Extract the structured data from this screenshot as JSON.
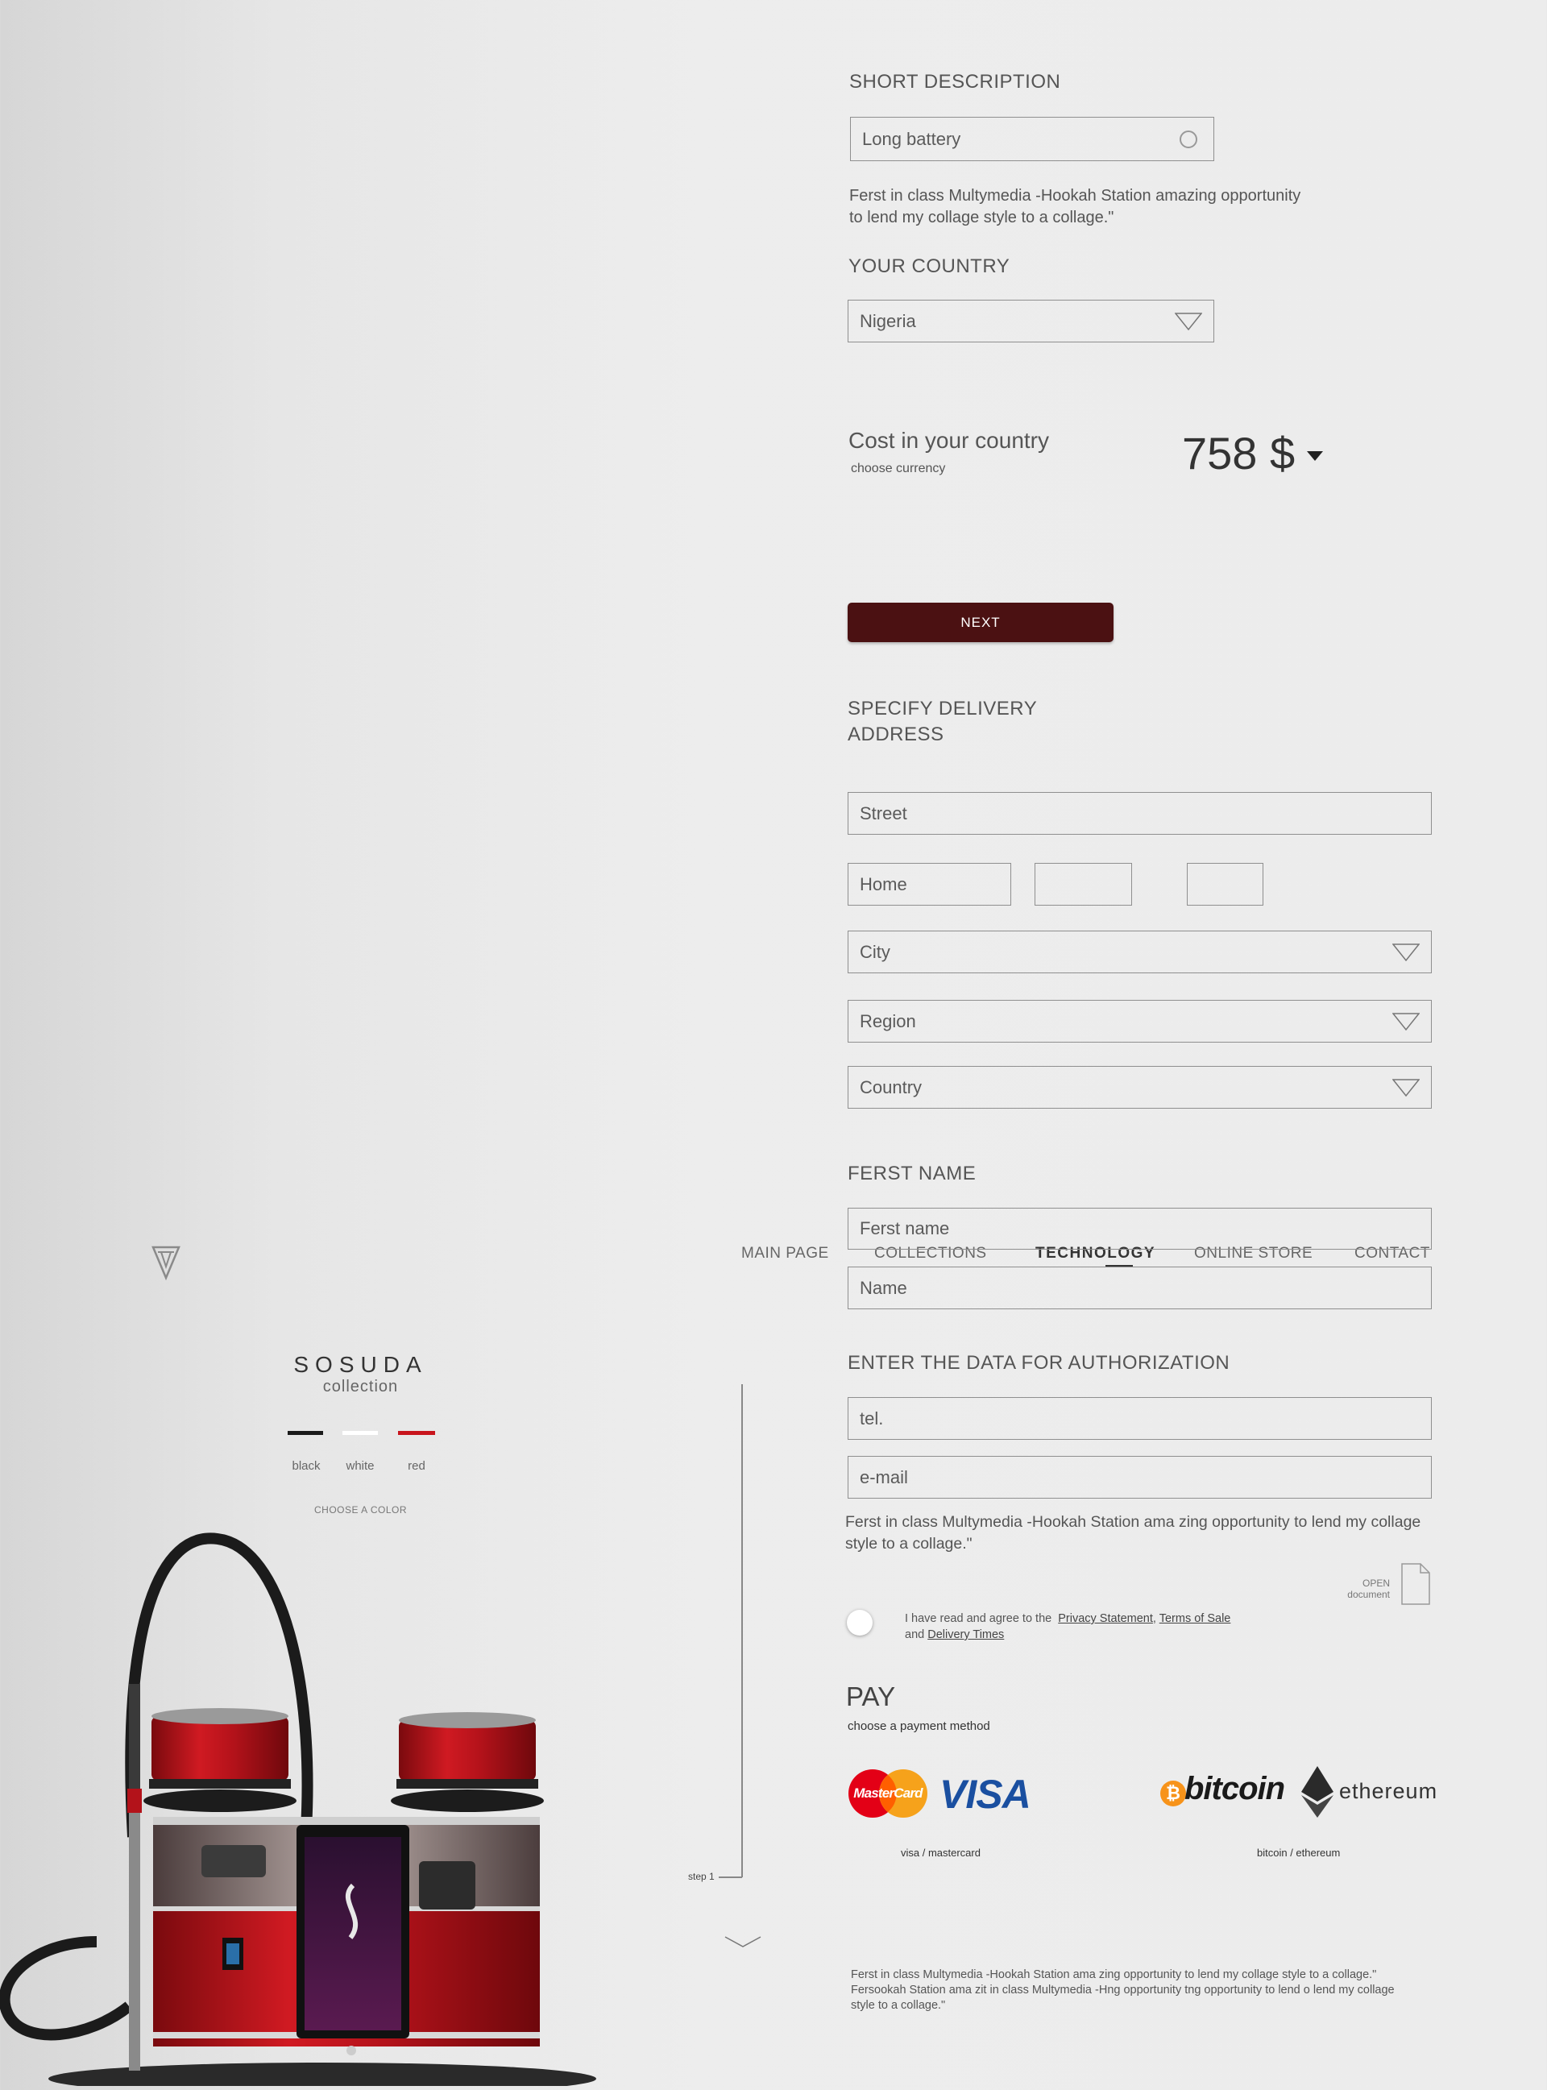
{
  "form": {
    "short_description_title": "SHORT DESCRIPTION",
    "short_description_value": "Long battery",
    "intro_text_line1": "Ferst in class Multymedia -Hookah Station amazing opportunity",
    "intro_text_line2": "to  lend my  collage  style to a  collage.\"",
    "country_title": "YOUR COUNTRY",
    "country_value": "Nigeria",
    "cost_label": "Cost in your country",
    "cost_sub": "choose currency",
    "price": "758 $",
    "next_label": "NEXT",
    "delivery_title_line1": "SPECIFY DELIVERY",
    "delivery_title_line2": "ADDRESS",
    "street_placeholder": "Street",
    "home_placeholder": "Home",
    "city_label": "City",
    "region_label": "Region",
    "country_label": "Country",
    "first_name_title": "FERST NAME",
    "first_name_placeholder": "Ferst name",
    "name_placeholder": "Name",
    "auth_title": "ENTER THE DATA FOR AUTHORIZATION",
    "tel_placeholder": "tel.",
    "email_placeholder": "e-mail",
    "auth_text_line1": "Ferst in class Multymedia -Hookah Station ama zing opportunity to lend my  collage",
    "auth_text_line2": "style to a collage.\"",
    "open_doc_line1": "OPEN",
    "open_doc_line2": "document",
    "agree_text_pre": "I have read and agree to the",
    "privacy_link": "Privacy Statement",
    "terms_link": "Terms of Sale",
    "agree_text_and": "and",
    "delivery_link": "Delivery Times",
    "pay_title": "PAY",
    "pay_sub": "choose a payment method",
    "card_caption": "visa / mastercard",
    "crypto_caption": "bitcoin / ethereum",
    "mastercard_text": "MasterCard",
    "visa_text": "VISA",
    "bitcoin_text": "bitcoin",
    "ethereum_text": "ethereum",
    "footer_line1": "Ferst in class Multymedia -Hookah Station ama zing opportunity to lend my  collage  style to a collage.\"",
    "footer_line2": "Fersookah Station ama zit in class Multymedia -Hng opportunity tng opportunity to lend o lend my  collage",
    "footer_line3": "style to a collage.\""
  },
  "nav": {
    "items": [
      "MAIN PAGE",
      "COLLECTIONS",
      "TECHNOLOGY",
      "ONLINE STORE",
      "CONTACT"
    ],
    "active": "TECHNOLOGY"
  },
  "product": {
    "name": "SOSUDA",
    "sub": "collection",
    "colors": [
      {
        "label": "black",
        "hex": "#1a1a1a"
      },
      {
        "label": "white",
        "hex": "#ffffff"
      },
      {
        "label": "red",
        "hex": "#c8141c"
      }
    ],
    "choose_color": "CHOOSE A COLOR",
    "step_label": "step 1"
  },
  "colors": {
    "accent": "#4b1112",
    "hookah_red": "#b3121a"
  }
}
